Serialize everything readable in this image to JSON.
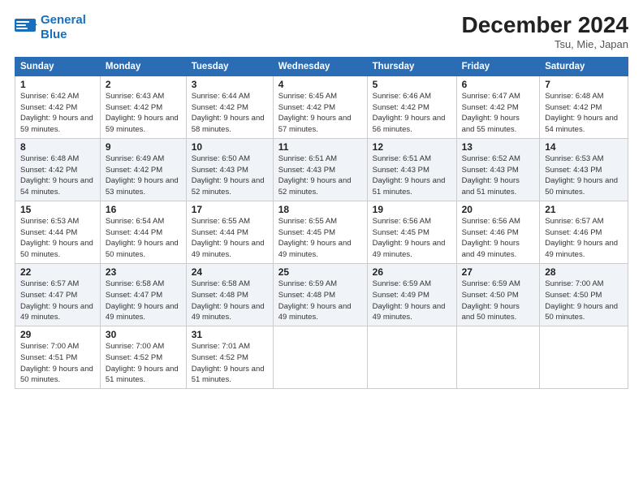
{
  "logo": {
    "line1": "General",
    "line2": "Blue"
  },
  "title": "December 2024",
  "subtitle": "Tsu, Mie, Japan",
  "columns": [
    "Sunday",
    "Monday",
    "Tuesday",
    "Wednesday",
    "Thursday",
    "Friday",
    "Saturday"
  ],
  "weeks": [
    [
      {
        "day": "1",
        "sunrise": "6:42 AM",
        "sunset": "4:42 PM",
        "daylight": "9 hours and 59 minutes."
      },
      {
        "day": "2",
        "sunrise": "6:43 AM",
        "sunset": "4:42 PM",
        "daylight": "9 hours and 59 minutes."
      },
      {
        "day": "3",
        "sunrise": "6:44 AM",
        "sunset": "4:42 PM",
        "daylight": "9 hours and 58 minutes."
      },
      {
        "day": "4",
        "sunrise": "6:45 AM",
        "sunset": "4:42 PM",
        "daylight": "9 hours and 57 minutes."
      },
      {
        "day": "5",
        "sunrise": "6:46 AM",
        "sunset": "4:42 PM",
        "daylight": "9 hours and 56 minutes."
      },
      {
        "day": "6",
        "sunrise": "6:47 AM",
        "sunset": "4:42 PM",
        "daylight": "9 hours and 55 minutes."
      },
      {
        "day": "7",
        "sunrise": "6:48 AM",
        "sunset": "4:42 PM",
        "daylight": "9 hours and 54 minutes."
      }
    ],
    [
      {
        "day": "8",
        "sunrise": "6:48 AM",
        "sunset": "4:42 PM",
        "daylight": "9 hours and 54 minutes."
      },
      {
        "day": "9",
        "sunrise": "6:49 AM",
        "sunset": "4:42 PM",
        "daylight": "9 hours and 53 minutes."
      },
      {
        "day": "10",
        "sunrise": "6:50 AM",
        "sunset": "4:43 PM",
        "daylight": "9 hours and 52 minutes."
      },
      {
        "day": "11",
        "sunrise": "6:51 AM",
        "sunset": "4:43 PM",
        "daylight": "9 hours and 52 minutes."
      },
      {
        "day": "12",
        "sunrise": "6:51 AM",
        "sunset": "4:43 PM",
        "daylight": "9 hours and 51 minutes."
      },
      {
        "day": "13",
        "sunrise": "6:52 AM",
        "sunset": "4:43 PM",
        "daylight": "9 hours and 51 minutes."
      },
      {
        "day": "14",
        "sunrise": "6:53 AM",
        "sunset": "4:43 PM",
        "daylight": "9 hours and 50 minutes."
      }
    ],
    [
      {
        "day": "15",
        "sunrise": "6:53 AM",
        "sunset": "4:44 PM",
        "daylight": "9 hours and 50 minutes."
      },
      {
        "day": "16",
        "sunrise": "6:54 AM",
        "sunset": "4:44 PM",
        "daylight": "9 hours and 50 minutes."
      },
      {
        "day": "17",
        "sunrise": "6:55 AM",
        "sunset": "4:44 PM",
        "daylight": "9 hours and 49 minutes."
      },
      {
        "day": "18",
        "sunrise": "6:55 AM",
        "sunset": "4:45 PM",
        "daylight": "9 hours and 49 minutes."
      },
      {
        "day": "19",
        "sunrise": "6:56 AM",
        "sunset": "4:45 PM",
        "daylight": "9 hours and 49 minutes."
      },
      {
        "day": "20",
        "sunrise": "6:56 AM",
        "sunset": "4:46 PM",
        "daylight": "9 hours and 49 minutes."
      },
      {
        "day": "21",
        "sunrise": "6:57 AM",
        "sunset": "4:46 PM",
        "daylight": "9 hours and 49 minutes."
      }
    ],
    [
      {
        "day": "22",
        "sunrise": "6:57 AM",
        "sunset": "4:47 PM",
        "daylight": "9 hours and 49 minutes."
      },
      {
        "day": "23",
        "sunrise": "6:58 AM",
        "sunset": "4:47 PM",
        "daylight": "9 hours and 49 minutes."
      },
      {
        "day": "24",
        "sunrise": "6:58 AM",
        "sunset": "4:48 PM",
        "daylight": "9 hours and 49 minutes."
      },
      {
        "day": "25",
        "sunrise": "6:59 AM",
        "sunset": "4:48 PM",
        "daylight": "9 hours and 49 minutes."
      },
      {
        "day": "26",
        "sunrise": "6:59 AM",
        "sunset": "4:49 PM",
        "daylight": "9 hours and 49 minutes."
      },
      {
        "day": "27",
        "sunrise": "6:59 AM",
        "sunset": "4:50 PM",
        "daylight": "9 hours and 50 minutes."
      },
      {
        "day": "28",
        "sunrise": "7:00 AM",
        "sunset": "4:50 PM",
        "daylight": "9 hours and 50 minutes."
      }
    ],
    [
      {
        "day": "29",
        "sunrise": "7:00 AM",
        "sunset": "4:51 PM",
        "daylight": "9 hours and 50 minutes."
      },
      {
        "day": "30",
        "sunrise": "7:00 AM",
        "sunset": "4:52 PM",
        "daylight": "9 hours and 51 minutes."
      },
      {
        "day": "31",
        "sunrise": "7:01 AM",
        "sunset": "4:52 PM",
        "daylight": "9 hours and 51 minutes."
      },
      null,
      null,
      null,
      null
    ]
  ]
}
